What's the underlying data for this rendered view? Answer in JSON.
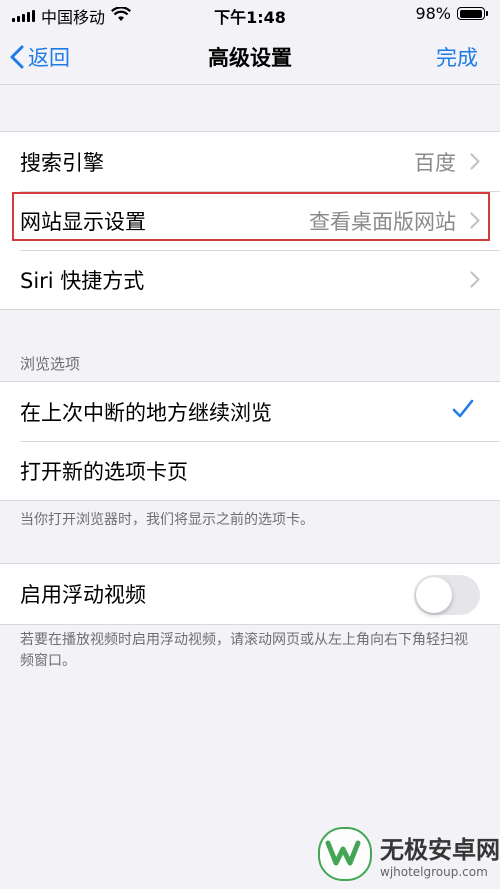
{
  "status_bar": {
    "carrier": "中国移动",
    "time": "下午1:48",
    "battery_text": "98%",
    "battery_level": 0.98
  },
  "nav": {
    "back_label": "返回",
    "title": "高级设置",
    "done_label": "完成",
    "accent_color": "#1f7be8"
  },
  "group1": {
    "rows": [
      {
        "label": "搜索引擎",
        "value": "百度"
      },
      {
        "label": "网站显示设置",
        "value": "查看桌面版网站"
      },
      {
        "label": "Siri 快捷方式",
        "value": ""
      }
    ]
  },
  "browse": {
    "header": "浏览选项",
    "rows": [
      {
        "label": "在上次中断的地方继续浏览",
        "checked": true
      },
      {
        "label": "打开新的选项卡页",
        "checked": false
      }
    ],
    "footer": "当你打开浏览器时，我们将显示之前的选项卡。"
  },
  "floating": {
    "label": "启用浮动视频",
    "enabled": false,
    "footer": "若要在播放视频时启用浮动视频，请滚动网页或从左上角向右下角轻扫视频窗口。"
  },
  "watermark": {
    "brand": "无极安卓网",
    "url": "wjhotelgroup.com"
  },
  "highlight_color": "#d43b3b"
}
